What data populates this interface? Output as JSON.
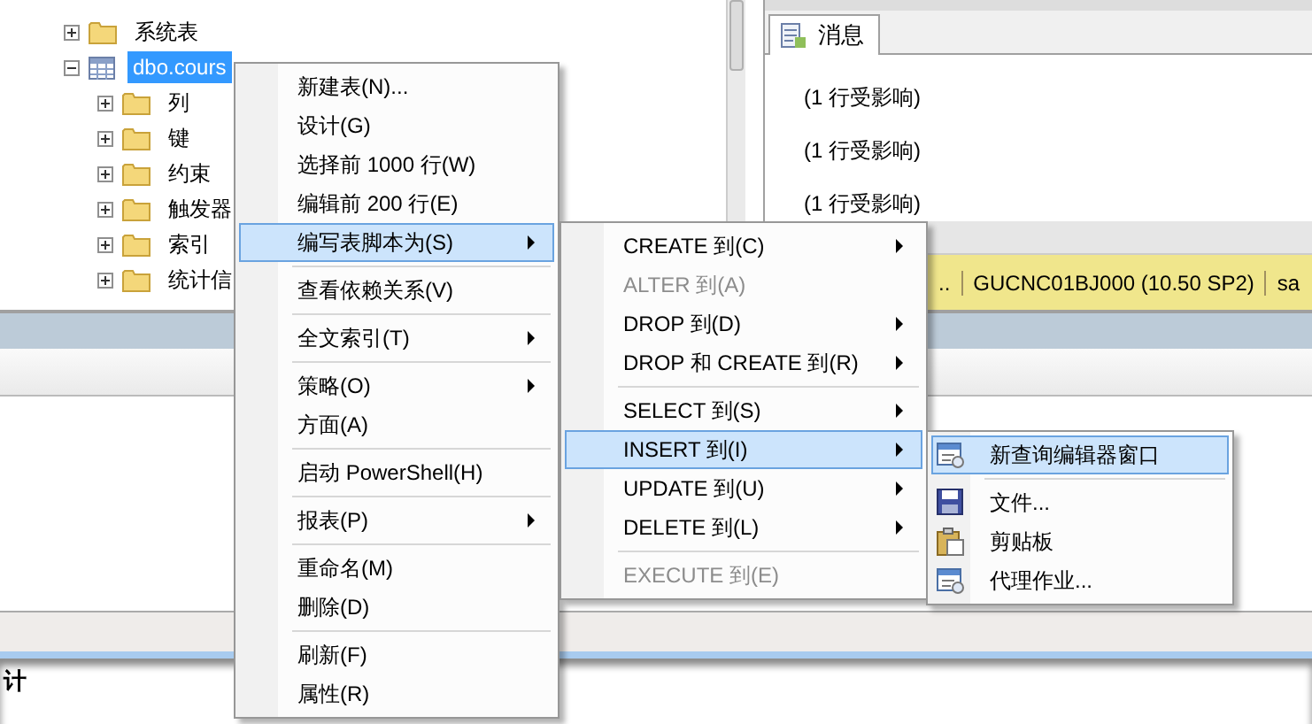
{
  "tree": [
    {
      "label": "系统表",
      "kind": "folder",
      "expanded": false,
      "selected": false
    },
    {
      "label": "dbo.cours",
      "kind": "table",
      "expanded": true,
      "selected": true,
      "children": [
        {
          "label": "列",
          "kind": "folder",
          "expanded": false,
          "selected": false
        },
        {
          "label": "键",
          "kind": "folder",
          "expanded": false,
          "selected": false
        },
        {
          "label": "约束",
          "kind": "folder",
          "expanded": false,
          "selected": false
        },
        {
          "label": "触发器",
          "kind": "folder",
          "expanded": false,
          "selected": false
        },
        {
          "label": "索引",
          "kind": "folder",
          "expanded": false,
          "selected": false
        },
        {
          "label": "统计信",
          "kind": "folder",
          "expanded": false,
          "selected": false
        }
      ]
    }
  ],
  "messages": {
    "tab": "消息",
    "lines": [
      "(1 行受影响)",
      "(1 行受影响)",
      "(1 行受影响)"
    ]
  },
  "status_bar": [
    "..",
    "GUCNC01BJ000 (10.50 SP2)",
    "sa"
  ],
  "heading": "计",
  "context_menu": [
    {
      "kind": "item",
      "label": "新建表(N)...",
      "selected": false,
      "disabled": false,
      "submenu": false
    },
    {
      "kind": "item",
      "label": "设计(G)",
      "selected": false,
      "disabled": false,
      "submenu": false
    },
    {
      "kind": "item",
      "label": "选择前 1000 行(W)",
      "selected": false,
      "disabled": false,
      "submenu": false
    },
    {
      "kind": "item",
      "label": "编辑前 200 行(E)",
      "selected": false,
      "disabled": false,
      "submenu": false
    },
    {
      "kind": "item",
      "label": "编写表脚本为(S)",
      "selected": true,
      "disabled": false,
      "submenu": true
    },
    {
      "kind": "separator"
    },
    {
      "kind": "item",
      "label": "查看依赖关系(V)",
      "selected": false,
      "disabled": false,
      "submenu": false
    },
    {
      "kind": "separator"
    },
    {
      "kind": "item",
      "label": "全文索引(T)",
      "selected": false,
      "disabled": false,
      "submenu": true
    },
    {
      "kind": "separator"
    },
    {
      "kind": "item",
      "label": "策略(O)",
      "selected": false,
      "disabled": false,
      "submenu": true
    },
    {
      "kind": "item",
      "label": "方面(A)",
      "selected": false,
      "disabled": false,
      "submenu": false
    },
    {
      "kind": "separator"
    },
    {
      "kind": "item",
      "label": "启动 PowerShell(H)",
      "selected": false,
      "disabled": false,
      "submenu": false
    },
    {
      "kind": "separator"
    },
    {
      "kind": "item",
      "label": "报表(P)",
      "selected": false,
      "disabled": false,
      "submenu": true
    },
    {
      "kind": "separator"
    },
    {
      "kind": "item",
      "label": "重命名(M)",
      "selected": false,
      "disabled": false,
      "submenu": false
    },
    {
      "kind": "item",
      "label": "删除(D)",
      "selected": false,
      "disabled": false,
      "submenu": false
    },
    {
      "kind": "separator"
    },
    {
      "kind": "item",
      "label": "刷新(F)",
      "selected": false,
      "disabled": false,
      "submenu": false
    },
    {
      "kind": "item",
      "label": "属性(R)",
      "selected": false,
      "disabled": false,
      "submenu": false
    }
  ],
  "script_menu": [
    {
      "kind": "item",
      "label": "CREATE 到(C)",
      "selected": false,
      "disabled": false,
      "submenu": true
    },
    {
      "kind": "item",
      "label": "ALTER 到(A)",
      "selected": false,
      "disabled": true,
      "submenu": false
    },
    {
      "kind": "item",
      "label": "DROP 到(D)",
      "selected": false,
      "disabled": false,
      "submenu": true
    },
    {
      "kind": "item",
      "label": "DROP 和 CREATE 到(R)",
      "selected": false,
      "disabled": false,
      "submenu": true
    },
    {
      "kind": "separator"
    },
    {
      "kind": "item",
      "label": "SELECT 到(S)",
      "selected": false,
      "disabled": false,
      "submenu": true
    },
    {
      "kind": "item",
      "label": "INSERT 到(I)",
      "selected": true,
      "disabled": false,
      "submenu": true
    },
    {
      "kind": "item",
      "label": "UPDATE 到(U)",
      "selected": false,
      "disabled": false,
      "submenu": true
    },
    {
      "kind": "item",
      "label": "DELETE 到(L)",
      "selected": false,
      "disabled": false,
      "submenu": true
    },
    {
      "kind": "separator"
    },
    {
      "kind": "item",
      "label": "EXECUTE 到(E)",
      "selected": false,
      "disabled": true,
      "submenu": false
    }
  ],
  "target_menu": [
    {
      "kind": "item",
      "label": "新查询编辑器窗口",
      "selected": true,
      "disabled": false,
      "submenu": false
    },
    {
      "kind": "separator"
    },
    {
      "kind": "item",
      "label": "文件...",
      "selected": false,
      "disabled": false,
      "submenu": false
    },
    {
      "kind": "item",
      "label": "剪贴板",
      "selected": false,
      "disabled": false,
      "submenu": false
    },
    {
      "kind": "item",
      "label": "代理作业...",
      "selected": false,
      "disabled": false,
      "submenu": false
    }
  ]
}
